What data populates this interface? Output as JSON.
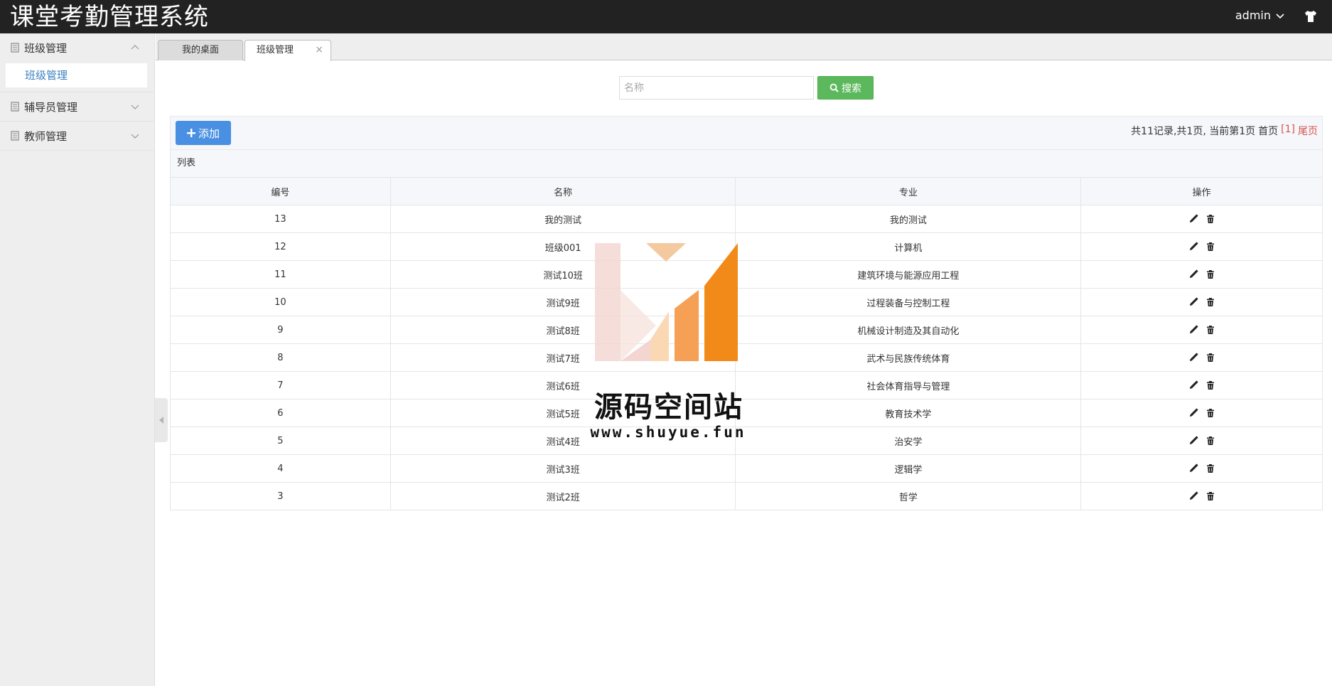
{
  "header": {
    "app_title": "课堂考勤管理系统",
    "user_name": "admin"
  },
  "sidebar": {
    "groups": [
      {
        "label": "班级管理",
        "expanded": true,
        "items": [
          {
            "label": "班级管理"
          }
        ]
      },
      {
        "label": "辅导员管理",
        "expanded": false
      },
      {
        "label": "教师管理",
        "expanded": false
      }
    ]
  },
  "tabs": [
    {
      "label": "我的桌面"
    },
    {
      "label": "班级管理",
      "active": true,
      "close": "×"
    }
  ],
  "search": {
    "placeholder": "名称",
    "button_label": "搜索"
  },
  "toolbar": {
    "add_label": "添加",
    "pager": {
      "summary": "共11记录,共1页, 当前第1页",
      "first": "首页",
      "current": "[1]",
      "last": "尾页"
    }
  },
  "list": {
    "caption": "列表",
    "columns": [
      "编号",
      "名称",
      "专业",
      "操作"
    ],
    "rows": [
      {
        "id": "13",
        "name": "我的测试",
        "major": "我的测试"
      },
      {
        "id": "12",
        "name": "班级001",
        "major": "计算机"
      },
      {
        "id": "11",
        "name": "测试10班",
        "major": "建筑环境与能源应用工程"
      },
      {
        "id": "10",
        "name": "测试9班",
        "major": "过程装备与控制工程"
      },
      {
        "id": "9",
        "name": "测试8班",
        "major": "机械设计制造及其自动化"
      },
      {
        "id": "8",
        "name": "测试7班",
        "major": "武术与民族传统体育"
      },
      {
        "id": "7",
        "name": "测试6班",
        "major": "社会体育指导与管理"
      },
      {
        "id": "6",
        "name": "测试5班",
        "major": "教育技术学"
      },
      {
        "id": "5",
        "name": "测试4班",
        "major": "治安学"
      },
      {
        "id": "4",
        "name": "测试3班",
        "major": "逻辑学"
      },
      {
        "id": "3",
        "name": "测试2班",
        "major": "哲学"
      }
    ]
  },
  "watermark": {
    "title": "源码空间站",
    "url": "www.shuyue.fun"
  },
  "colors": {
    "header_bg": "#222222",
    "search_button": "#5cb85c",
    "add_button": "#4a90e2",
    "pager_active": "#d9534f",
    "sidebar_link": "#3a7fc1"
  }
}
